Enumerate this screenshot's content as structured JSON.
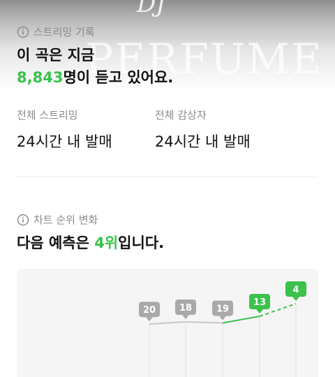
{
  "banner": {
    "logo_text": "DJ",
    "background_text": "PERFUME"
  },
  "streaming": {
    "section_label": "스트리밍 기록",
    "headline_line1": "이 곡은 지금",
    "listener_count": "8,843",
    "headline_line2_suffix": "명이 듣고 있어요.",
    "stats": [
      {
        "label": "전체 스트리밍",
        "value": "24시간 내 발매"
      },
      {
        "label": "전체 감상자",
        "value": "24시간 내 발매"
      }
    ]
  },
  "rank": {
    "section_label": "차트 순위 변화",
    "headline_prefix": "다음 예측은 ",
    "predicted_rank": "4위",
    "headline_suffix": "입니다."
  },
  "colors": {
    "accent_green": "#3ac24b",
    "gray_badge": "#a9a9a9"
  },
  "chart_data": {
    "type": "line",
    "title": "",
    "points": [
      {
        "rank": 20,
        "kind": "actual"
      },
      {
        "rank": 18,
        "kind": "actual"
      },
      {
        "rank": 19,
        "kind": "actual"
      },
      {
        "rank": 13,
        "kind": "current"
      },
      {
        "rank": 4,
        "kind": "predicted"
      }
    ],
    "y_direction": "inverted"
  }
}
